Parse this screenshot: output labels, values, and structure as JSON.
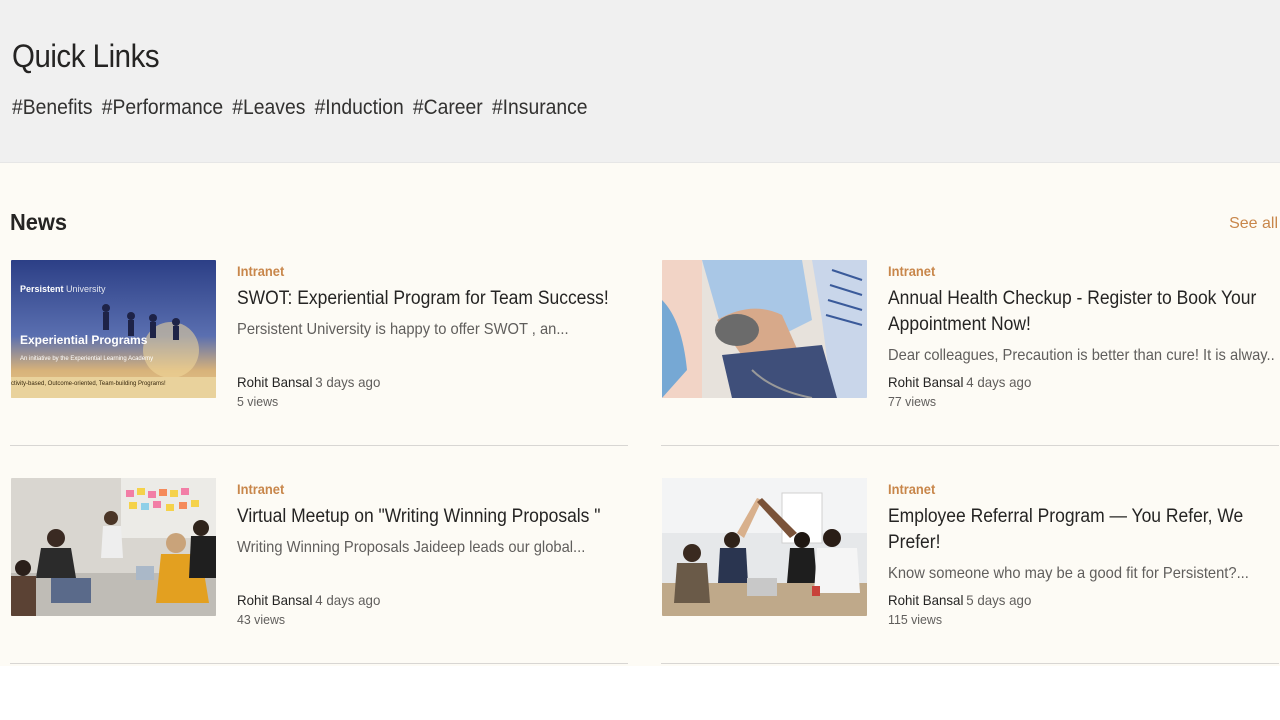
{
  "quick_links": {
    "title": "Quick Links",
    "tags": [
      "#Benefits",
      "#Performance",
      "#Leaves",
      "#Induction",
      "#Career",
      "#Insurance"
    ]
  },
  "news": {
    "title": "News",
    "see_all": "See all",
    "items": [
      {
        "category": "Intranet",
        "headline": "SWOT: Experiential Program for Team Success!",
        "excerpt": "Persistent University is happy to offer SWOT , an...",
        "author": "Rohit Bansal",
        "ago": "3 days ago",
        "views": "5 views",
        "thumb": {
          "brand": "Persistent",
          "brand_sub": "University",
          "heading": "Experiential Programs",
          "subheading": "An initiative by the Experiential Learning Academy",
          "footer": "ctivity-based, Outcome-oriented, Team-building Programs!"
        }
      },
      {
        "category": "Intranet",
        "headline": "Annual Health Checkup - Register to Book Your Appointment Now!",
        "excerpt": "Dear colleagues, Precaution is better than cure! It is alway...",
        "author": "Rohit Bansal",
        "ago": "4 days ago",
        "views": "77 views"
      },
      {
        "category": "Intranet",
        "headline": "Virtual Meetup on \"Writing Winning Proposals \"",
        "excerpt": "Writing Winning Proposals Jaideep leads our global...",
        "author": "Rohit Bansal",
        "ago": "4 days ago",
        "views": "43 views"
      },
      {
        "category": "Intranet",
        "headline": "Employee Referral Program — You Refer, We Prefer!",
        "excerpt": "Know someone who may be a good fit for Persistent?...",
        "author": "Rohit Bansal",
        "ago": "5 days ago",
        "views": "115 views"
      }
    ]
  },
  "colors": {
    "accent": "#c8864a",
    "quick_bg": "#f0f0f0",
    "news_bg": "#fdfbf5"
  }
}
